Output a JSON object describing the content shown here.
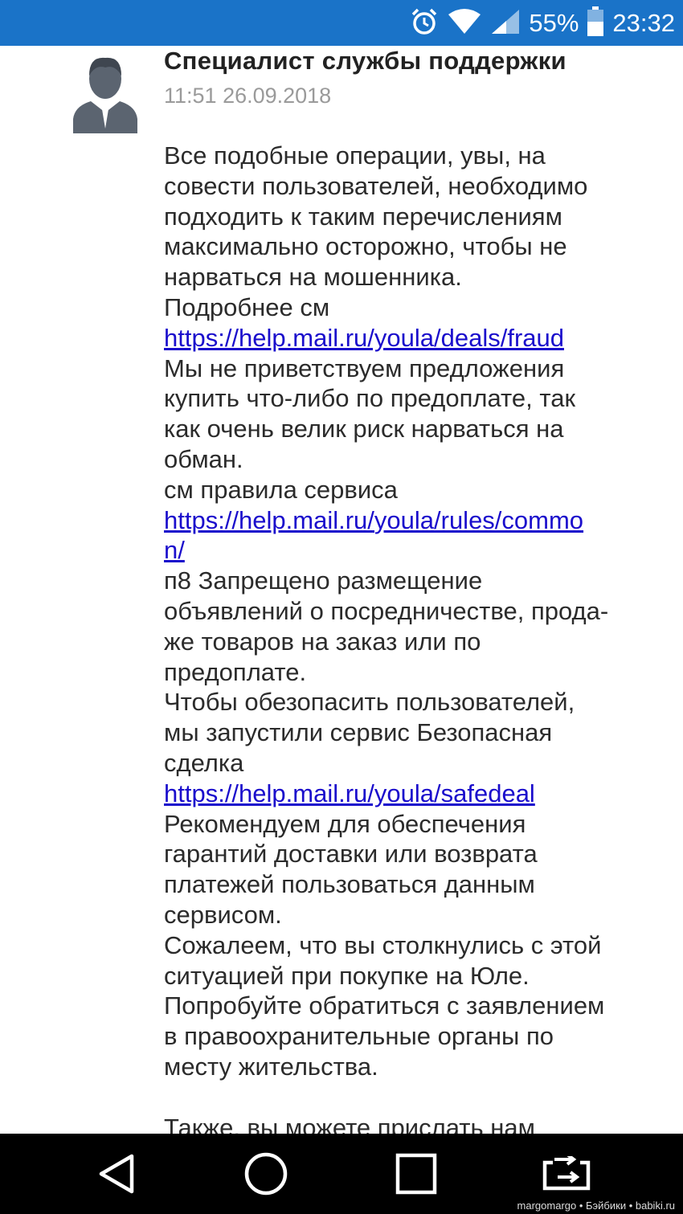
{
  "status_bar": {
    "battery_percent": "55%",
    "time": "23:32",
    "icons": [
      "alarm-icon",
      "wifi-icon",
      "cell-signal-icon",
      "battery-icon"
    ]
  },
  "message": {
    "sender": "Специалист службы поддержки",
    "timestamp": "11:51 26.09.2018",
    "lines": [
      {
        "text": "Все подобные операции, увы, на"
      },
      {
        "text": "совести пользователей, необходимо"
      },
      {
        "text": "подходить к таким перечислениям"
      },
      {
        "text": "максимально осторожно, чтобы не"
      },
      {
        "text": "нарваться на мошенника."
      },
      {
        "text": "Подробнее см"
      },
      {
        "text": "https://help.mail.ru/youla/deals/fraud",
        "link": true
      },
      {
        "text": "Мы не приветствуем предложения"
      },
      {
        "text": "купить что-либо по предоплате, так"
      },
      {
        "text": "как очень велик риск нарваться на"
      },
      {
        "text": "обман."
      },
      {
        "text": "см правила сервиса"
      },
      {
        "text": "https://help.mail.ru/youla/rules/commo",
        "link": true
      },
      {
        "text": "n/",
        "link": true
      },
      {
        "text": "п8 Запрещено размещение"
      },
      {
        "text": "объявлений о посредничестве, прода-"
      },
      {
        "text": "же товаров на заказ или по"
      },
      {
        "text": "предоплате."
      },
      {
        "text": "Чтобы обезопасить пользователей,"
      },
      {
        "text": "мы запустили сервис Безопасная"
      },
      {
        "text": "сделка"
      },
      {
        "text": "https://help.mail.ru/youla/safedeal",
        "link": true
      },
      {
        "text": "Рекомендуем для обеспечения"
      },
      {
        "text": "гарантий доставки или возврата"
      },
      {
        "text": "платежей пользоваться данным"
      },
      {
        "text": "сервисом."
      },
      {
        "text": "Сожалеем, что вы столкнулись с этой"
      },
      {
        "text": "ситуацией при покупке на Юле."
      },
      {
        "text": "Попробуйте обратиться с заявлением"
      },
      {
        "text": "в правоохранительные органы по"
      },
      {
        "text": "месту жительства."
      },
      {
        "text": ""
      },
      {
        "text": "Также, вы можете прислать нам"
      }
    ]
  },
  "nav_bar": {
    "buttons": [
      "back-icon",
      "home-icon",
      "recents-icon",
      "switch-app-icon"
    ]
  },
  "watermark": "margomargo • Бэйбики • babiki.ru",
  "colors": {
    "status_bar": "#1a73c8",
    "link": "#1a0dcc",
    "text": "#2b2b2b",
    "timestamp": "#9a9a9a",
    "avatar": "#5b6470"
  }
}
